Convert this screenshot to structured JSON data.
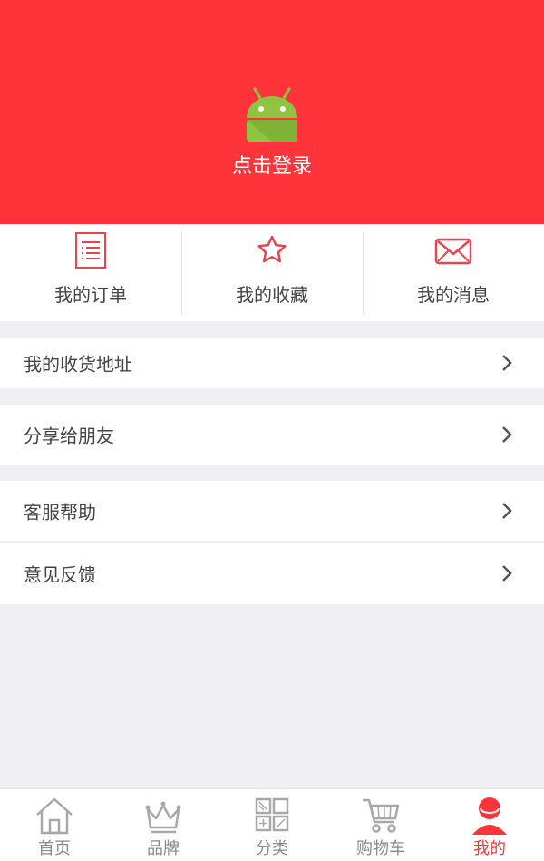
{
  "header": {
    "avatar_icon": "android-avatar-icon",
    "login_label": "点击登录",
    "background_color": "#ff343b"
  },
  "quick_actions": [
    {
      "icon": "order-list-icon",
      "label": "我的订单"
    },
    {
      "icon": "star-icon",
      "label": "我的收藏"
    },
    {
      "icon": "envelope-icon",
      "label": "我的消息"
    }
  ],
  "menu": [
    {
      "label": "我的收货地址"
    },
    {
      "label": "分享给朋友"
    },
    {
      "label": "客服帮助"
    },
    {
      "label": "意见反馈"
    }
  ],
  "tabbar": {
    "active_index": 4,
    "active_color": "#ff343b",
    "tabs": [
      {
        "icon": "home-icon",
        "label": "首页"
      },
      {
        "icon": "crown-icon",
        "label": "品牌"
      },
      {
        "icon": "category-grid-icon",
        "label": "分类"
      },
      {
        "icon": "cart-icon",
        "label": "购物车"
      },
      {
        "icon": "user-icon",
        "label": "我的"
      }
    ]
  }
}
